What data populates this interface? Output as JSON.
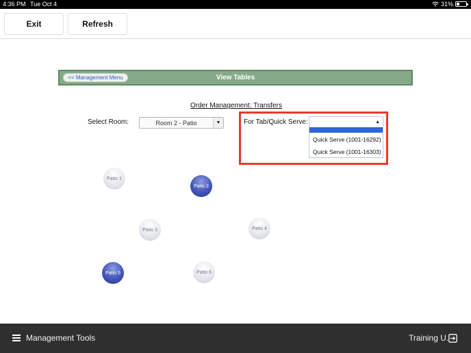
{
  "status_bar": {
    "time": "4:36 PM",
    "date": "Tue Oct 4",
    "battery": "31%",
    "battery_level": 0.31
  },
  "toolbar": {
    "exit_label": "Exit",
    "refresh_label": "Refresh"
  },
  "header": {
    "back_label": "<< Management Menu",
    "title": "View Tables"
  },
  "subtitle": "Order Management: Transfers",
  "room": {
    "label": "Select Room:",
    "selected": "Room 2 - Patio"
  },
  "tab_select": {
    "label": "For Tab/Quick Serve:",
    "options": [
      "Quick Serve (1001-16292)",
      "Quick Serve (1001-16303)"
    ]
  },
  "tables": [
    {
      "name": "Patio 1",
      "state": "available"
    },
    {
      "name": "Patio 2",
      "state": "occupied"
    },
    {
      "name": "Patio 3",
      "state": "available"
    },
    {
      "name": "Patio 4",
      "state": "available"
    },
    {
      "name": "Patio 5",
      "state": "occupied"
    },
    {
      "name": "Patio 6",
      "state": "available"
    }
  ],
  "colors": {
    "header_bg": "#86a98a",
    "highlight": "#e43b2c",
    "selected_option": "#2f66d6",
    "occupied_table": "#4456b8",
    "bottom_bar": "#2f2f2f"
  },
  "bottom_bar": {
    "menu_label": "Management Tools",
    "user_label": "Training U."
  }
}
